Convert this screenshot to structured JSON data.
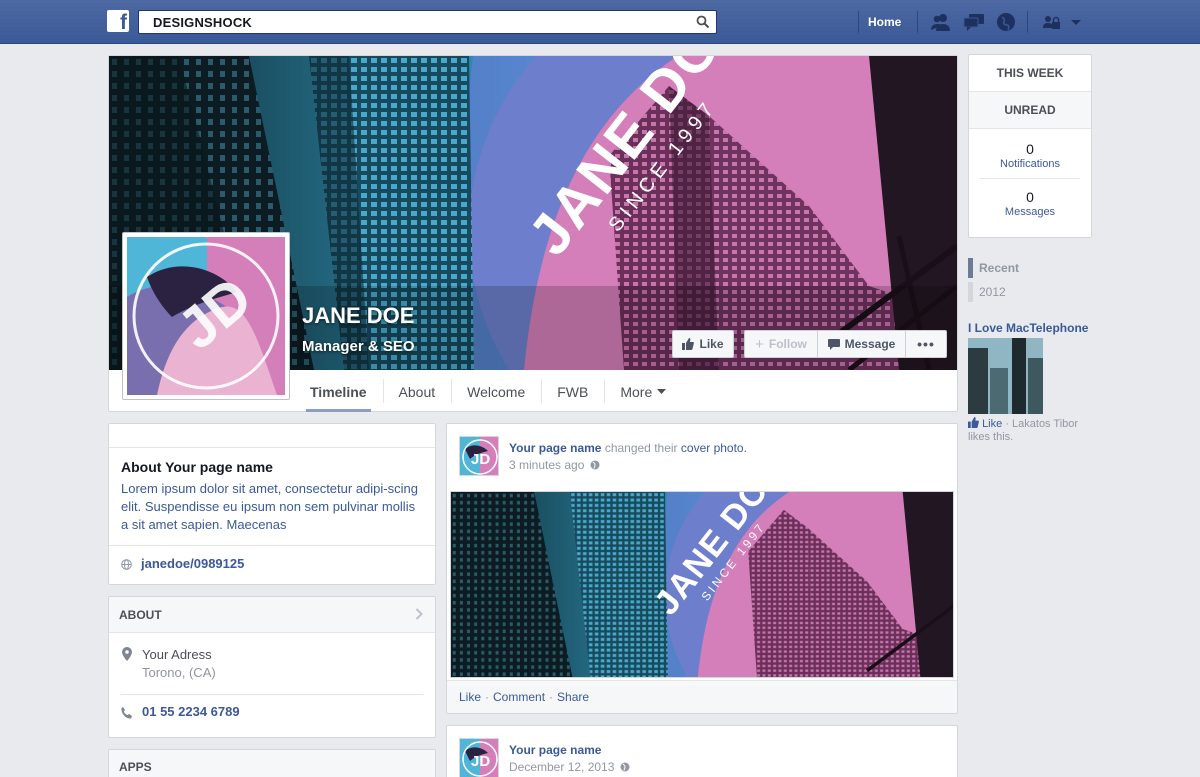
{
  "topbar": {
    "logo": "f",
    "search_value": "DESIGNSHOCK",
    "home_label": "Home"
  },
  "profile": {
    "name": "JANE DOE",
    "role": "Manager & SEO",
    "cover_text": "JANE DOE",
    "cover_subtext": "SINCE 1997",
    "avatar_monogram": "JD",
    "actions": {
      "like": "Like",
      "follow": "Follow",
      "message": "Message",
      "more": "•••"
    },
    "tabs": [
      "Timeline",
      "About",
      "Welcome",
      "FWB",
      "More"
    ]
  },
  "sidebar_right": {
    "this_week": "THIS WEEK",
    "unread": "UNREAD",
    "notifications": {
      "count": "0",
      "label": "Notifications"
    },
    "messages": {
      "count": "0",
      "label": "Messages"
    },
    "timeline_years": [
      "Recent",
      "2012"
    ],
    "ad": {
      "title": "I Love MacTelephone",
      "like_link": "Like",
      "like_text": "· Lakatos Tibor likes this."
    }
  },
  "about": {
    "title": "About Your page name",
    "description": "Lorem ipsum dolor sit amet, consectetur adipi-scing elit. Suspendisse eu ipsum non sem pulvinar mollis a sit amet sapien. Maecenas",
    "link": "janedoe/0989125"
  },
  "info": {
    "heading": "ABOUT",
    "address_line1": "Your Adress",
    "address_line2": "Torono, (CA)",
    "phone": "01 55 2234 6789"
  },
  "apps": {
    "heading": "APPS"
  },
  "posts": [
    {
      "author": "Your page name",
      "action": "changed their",
      "object": "cover photo.",
      "time": "3 minutes ago",
      "actions": [
        "Like",
        "Comment",
        "Share"
      ]
    },
    {
      "author": "Your page name",
      "time": "December 12, 2013"
    }
  ],
  "colors": {
    "facebook_blue": "#3b5998",
    "page_bg": "#e9eaed",
    "cover_pink": "#d87fb8",
    "cover_cyan": "#4fb8d8"
  }
}
